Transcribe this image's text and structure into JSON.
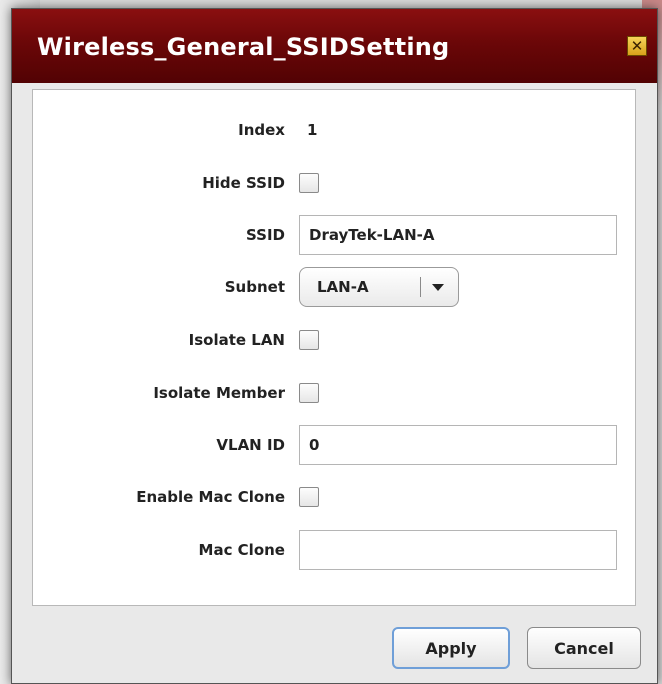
{
  "window": {
    "title": "Wireless_General_SSIDSetting"
  },
  "form": {
    "index": {
      "label": "Index",
      "value": "1"
    },
    "hide_ssid": {
      "label": "Hide SSID",
      "checked": false
    },
    "ssid": {
      "label": "SSID",
      "value": "DrayTek-LAN-A"
    },
    "subnet": {
      "label": "Subnet",
      "value": "LAN-A"
    },
    "isolate_lan": {
      "label": "Isolate LAN",
      "checked": false
    },
    "isolate_member": {
      "label": "Isolate Member",
      "checked": false
    },
    "vlan_id": {
      "label": "VLAN ID",
      "value": "0"
    },
    "enable_mac_clone": {
      "label": "Enable Mac Clone",
      "checked": false
    },
    "mac_clone": {
      "label": "Mac Clone",
      "value": ""
    }
  },
  "buttons": {
    "apply": "Apply",
    "cancel": "Cancel"
  },
  "icons": {
    "close": "close-icon",
    "dropdown": "chevron-down-icon"
  },
  "colors": {
    "titlebar": "#6b0708",
    "apply_border": "#6f9fd8"
  }
}
